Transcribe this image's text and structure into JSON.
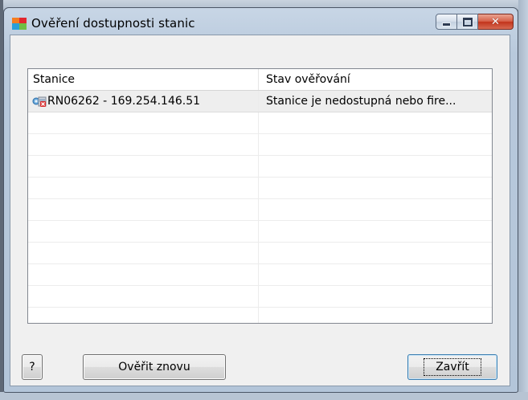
{
  "window": {
    "title": "Ověření dostupnosti stanic",
    "close_glyph": "✕"
  },
  "list": {
    "columns": [
      "Stanice",
      "Stav ověřování"
    ],
    "rows": [
      {
        "station": "RN06262 - 169.254.146.51",
        "status": "Stanice je nedostupná nebo fire...",
        "icon": "station-unreachable-icon"
      }
    ]
  },
  "buttons": {
    "help_label": "?",
    "recheck_label": "Ověřit znovu",
    "close_label": "Zavřít"
  },
  "colors": {
    "selected_row": "#eeeeee",
    "close_button_red": "#c2341c"
  }
}
